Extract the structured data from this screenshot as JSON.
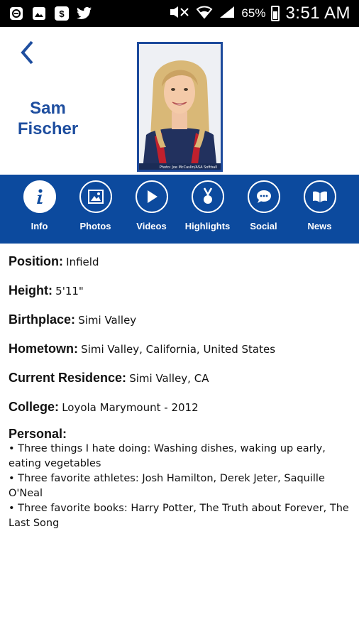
{
  "status_bar": {
    "left_icons": [
      "notification-icon",
      "image-icon",
      "dollar-icon",
      "twitter-icon"
    ],
    "battery": "65%",
    "time": "3:51 AM"
  },
  "profile": {
    "name": "Sam Fischer",
    "back_icon": "chevron-left-icon",
    "photo_caption": "Photo: Joe McCaslin/ASA Softball"
  },
  "nav": {
    "items": [
      {
        "label": "Info",
        "icon": "info-icon",
        "active": true
      },
      {
        "label": "Photos",
        "icon": "photo-icon",
        "active": false
      },
      {
        "label": "Videos",
        "icon": "play-icon",
        "active": false
      },
      {
        "label": "Highlights",
        "icon": "medal-icon",
        "active": false
      },
      {
        "label": "Social",
        "icon": "chat-icon",
        "active": false
      },
      {
        "label": "News",
        "icon": "book-icon",
        "active": false
      }
    ]
  },
  "info": {
    "position": {
      "label": "Position:",
      "value": "Infield"
    },
    "height": {
      "label": "Height:",
      "value": "5'11\""
    },
    "birthplace": {
      "label": "Birthplace:",
      "value": "Simi Valley"
    },
    "hometown": {
      "label": "Hometown:",
      "value": "Simi Valley, California, United States"
    },
    "residence": {
      "label": "Current Residence:",
      "value": "Simi Valley, CA"
    },
    "college": {
      "label": "College:",
      "value": "Loyola Marymount - 2012"
    },
    "personal": {
      "label": "Personal:",
      "items": [
        "• Three things I hate doing: Washing dishes, waking up early, eating vegetables",
        "• Three favorite athletes: Josh Hamilton, Derek Jeter, Saquille O'Neal",
        "• Three favorite books: Harry Potter, The Truth about Forever, The Last Song"
      ]
    }
  },
  "colors": {
    "brand_blue": "#0c4a9e",
    "name_blue": "#1e4e9f"
  }
}
